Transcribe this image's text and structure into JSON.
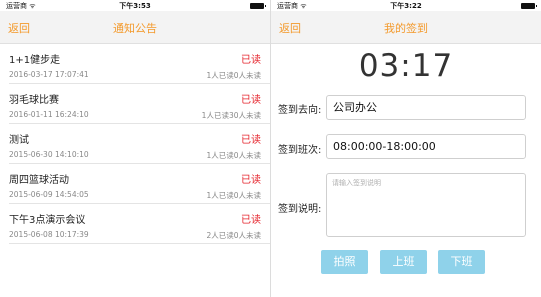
{
  "left": {
    "status": {
      "carrier": "运营商 ᯤ",
      "time": "下午3:53"
    },
    "nav": {
      "back": "返回",
      "title": "通知公告"
    },
    "notices": [
      {
        "title": "1+1健步走",
        "status": "已读",
        "date": "2016-03-17 17:07:41",
        "count": "1人已读0人未读"
      },
      {
        "title": "羽毛球比赛",
        "status": "已读",
        "date": "2016-01-11 16:24:10",
        "count": "1人已读30人未读"
      },
      {
        "title": "测试",
        "status": "已读",
        "date": "2015-06-30 14:10:10",
        "count": "1人已读0人未读"
      },
      {
        "title": "周四篮球活动",
        "status": "已读",
        "date": "2015-06-09 14:54:05",
        "count": "1人已读0人未读"
      },
      {
        "title": "下午3点演示会议",
        "status": "已读",
        "date": "2015-06-08 10:17:39",
        "count": "2人已读0人未读"
      }
    ]
  },
  "right": {
    "status": {
      "carrier": "运营商 ᯤ",
      "time": "下午3:22"
    },
    "nav": {
      "back": "返回",
      "title": "我的签到"
    },
    "clock": "03:17",
    "form": {
      "dest_label": "签到去向:",
      "dest_value": "公司办公",
      "shift_label": "签到班次:",
      "shift_value": "08:00:00-18:00:00",
      "note_label": "签到说明:",
      "note_placeholder": "请输入签到说明"
    },
    "buttons": {
      "photo": "拍照",
      "clock_in": "上班",
      "clock_out": "下班"
    }
  }
}
